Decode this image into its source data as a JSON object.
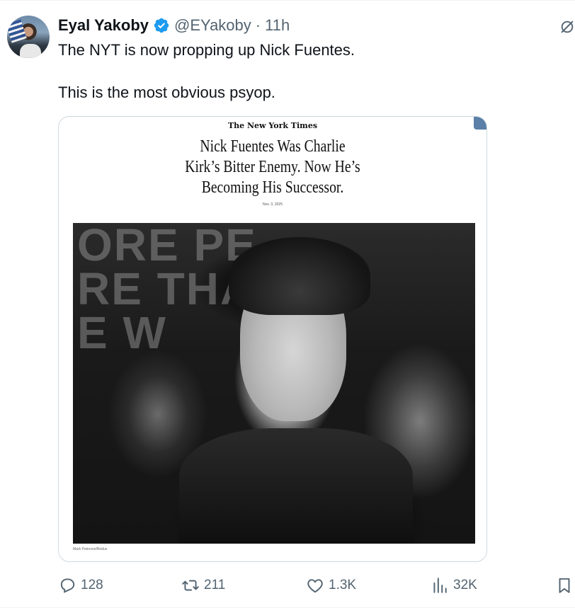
{
  "tweet": {
    "author_name": "Eyal Yakoby",
    "handle": "@EYakoby",
    "separator": "·",
    "time": "11h",
    "text_line_1": "The NYT is now propping up Nick Fuentes.",
    "text_line_2": "This is the most obvious psyop."
  },
  "media": {
    "publication": "The New York Times",
    "headline_line_1": "Nick Fuentes Was Charlie",
    "headline_line_2": "Kirk’s Bitter Enemy. Now He’s",
    "headline_line_3": "Becoming His Successor.",
    "date": "Nov. 3, 2025",
    "photo_credit": "Mark Peterson/Redux",
    "background_sign_text": "ORE PE\nRE THA\nE W"
  },
  "actions": {
    "replies": "128",
    "reposts": "211",
    "likes": "1.3K",
    "views": "32K"
  },
  "icons": {
    "verified": "verified-badge-icon",
    "grok": "grok-icon",
    "reply": "reply-icon",
    "repost": "repost-icon",
    "like": "like-icon",
    "views": "views-icon",
    "bookmark": "bookmark-icon"
  },
  "colors": {
    "verified_blue": "#1d9bf0",
    "text_primary": "#0f1419",
    "text_secondary": "#536471",
    "border": "#cfd9de"
  }
}
